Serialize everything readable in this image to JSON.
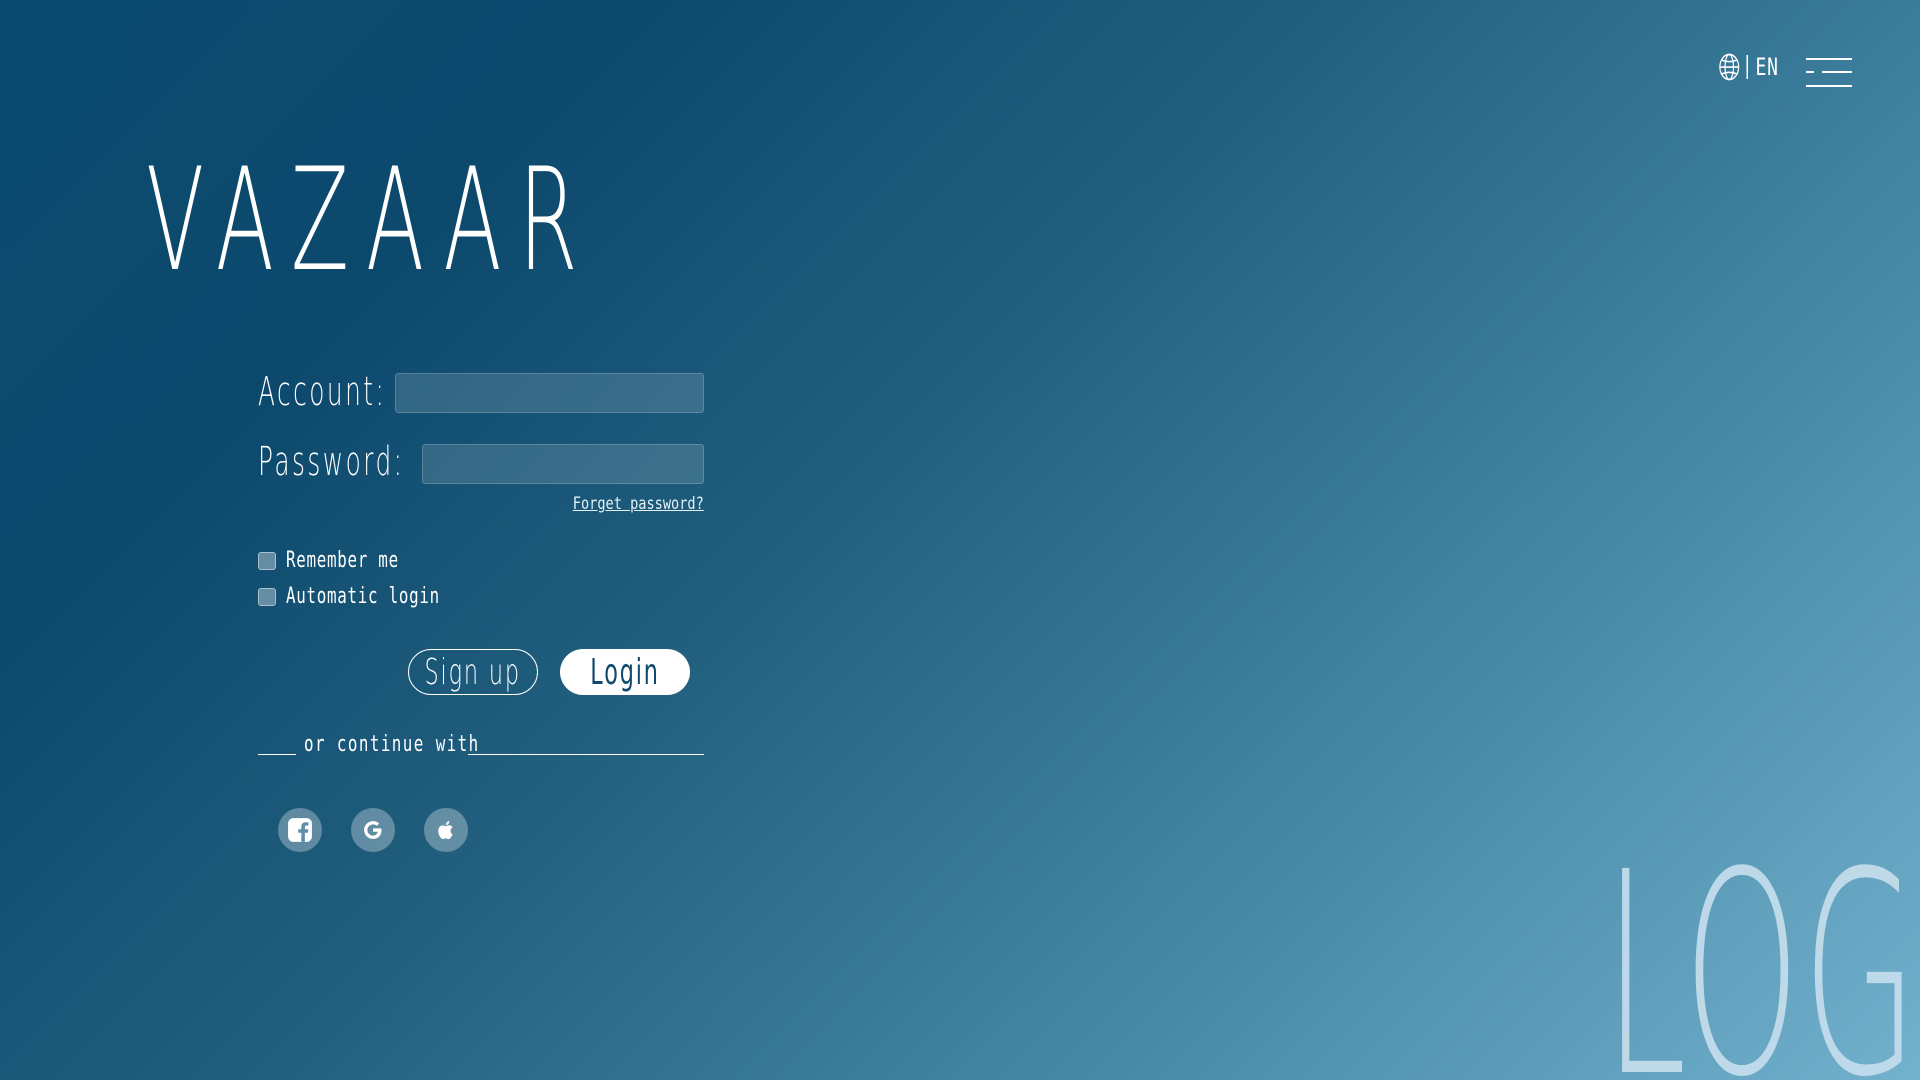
{
  "header": {
    "language_code": "EN",
    "language_icon": "globe-icon",
    "menu_icon": "hamburger-menu-icon"
  },
  "brand": {
    "title": "VAZAAR"
  },
  "form": {
    "account_label": "Account:",
    "account_value": "",
    "password_label": "Password:",
    "password_value": "",
    "forgot_password": "Forget password?",
    "remember_me": "Remember me",
    "automatic_login": "Automatic login",
    "signup_label": "Sign up",
    "login_label": "Login",
    "divider_text": "or continue with"
  },
  "social": [
    {
      "icon": "facebook-icon"
    },
    {
      "icon": "google-icon"
    },
    {
      "icon": "apple-icon"
    }
  ],
  "logo_text": "LOGO",
  "colors": {
    "primary_dark": "#0b4a70",
    "gradient_light": "#73b1cd",
    "login_text": "#0f4a6e",
    "logo_text": "#c3dceb"
  }
}
